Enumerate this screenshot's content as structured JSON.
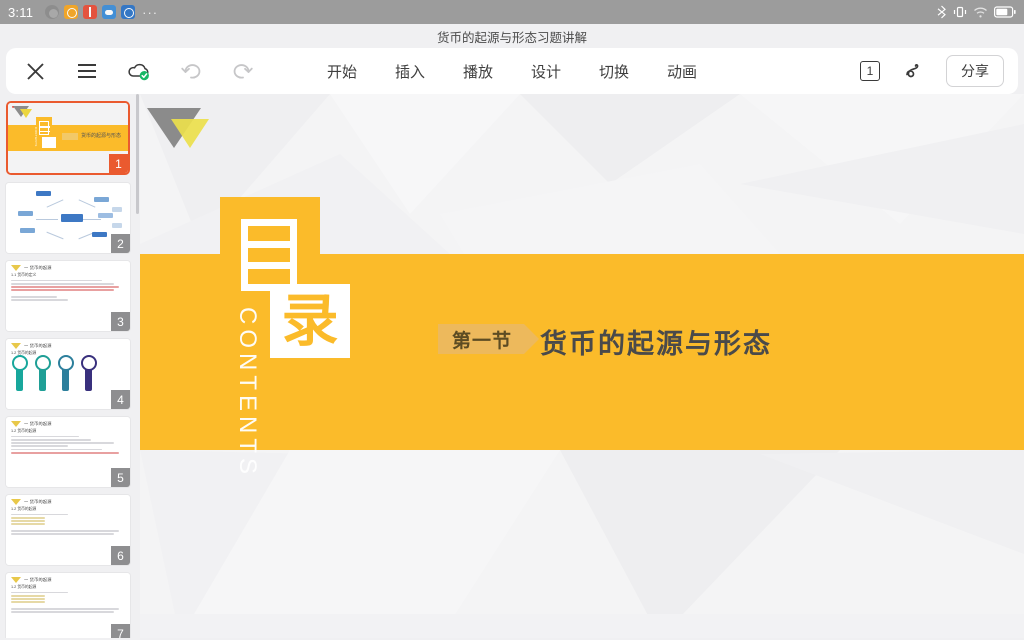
{
  "statusbar": {
    "time": "3:11",
    "left_icons": [
      "wechat-icon",
      "alipay-icon",
      "book-icon",
      "cloud-icon",
      "globe-icon",
      "more-dots-icon"
    ],
    "more": "···",
    "right_icons": [
      "bluetooth-icon",
      "vibrate-icon",
      "wifi-icon",
      "battery-icon"
    ]
  },
  "titlebar": {
    "document_title": "货币的起源与形态习题讲解"
  },
  "toolbar": {
    "close_label": "✕",
    "menu_label": "☰",
    "cloud_label": "cloud-saved",
    "undo_label": "undo",
    "redo_label": "redo",
    "tabs": [
      {
        "label": "开始"
      },
      {
        "label": "插入"
      },
      {
        "label": "播放"
      },
      {
        "label": "设计"
      },
      {
        "label": "切换"
      },
      {
        "label": "动画"
      }
    ],
    "slide_counter": "1",
    "pen_label": "scribble-pen",
    "share_label": "分享"
  },
  "thumbnails": {
    "selected_index": 1,
    "items": [
      {
        "number": "1",
        "kind": "title-slide"
      },
      {
        "number": "2",
        "kind": "mindmap"
      },
      {
        "number": "3",
        "kind": "text"
      },
      {
        "number": "4",
        "kind": "keys"
      },
      {
        "number": "5",
        "kind": "text"
      },
      {
        "number": "6",
        "kind": "text"
      },
      {
        "number": "7",
        "kind": "text"
      }
    ],
    "slide_header": "一 货币的起源",
    "sub_1_1": "1.1 货币的定义",
    "sub_1_2": "1.2 货币的起源"
  },
  "slide": {
    "mu_char": "目",
    "lu_char": "录",
    "contents_label": "CONTENTS",
    "section_tag": "第一节",
    "section_title": "货币的起源与形态",
    "accent_color": "#fbbb2a",
    "tag_color": "#edb95c",
    "title_color": "#4a4a4a",
    "background_color": "#f4f4f5"
  }
}
